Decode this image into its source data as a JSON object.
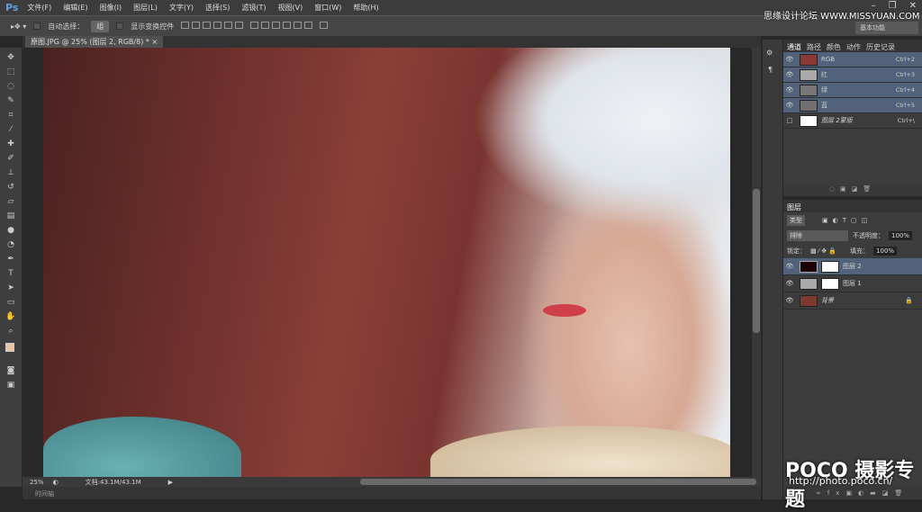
{
  "app": {
    "logo": "Ps",
    "window_controls": [
      "–",
      "❐",
      "✕"
    ]
  },
  "menu": [
    "文件(F)",
    "编辑(E)",
    "图像(I)",
    "图层(L)",
    "文字(Y)",
    "选择(S)",
    "滤镜(T)",
    "视图(V)",
    "窗口(W)",
    "帮助(H)"
  ],
  "options": {
    "auto_select_label": "自动选择：",
    "auto_select_value": "组",
    "show_transform_label": "显示变换控件",
    "workspace": "基本功能"
  },
  "watermark": "思缘设计论坛 WWW.MISSYUAN.COM",
  "document": {
    "tab_title": "原图.JPG @ 25% (图层 2, RGB/8) *",
    "close": "×",
    "zoom": "25%",
    "doc_size": "文档:43.1M/43.1M"
  },
  "timeline_label": "时间轴",
  "channels_panel": {
    "tabs": [
      "通道",
      "路径",
      "颜色",
      "动作",
      "历史记录"
    ],
    "rows": [
      {
        "name": "RGB",
        "shortcut": "Ctrl+2"
      },
      {
        "name": "红",
        "shortcut": "Ctrl+3"
      },
      {
        "name": "绿",
        "shortcut": "Ctrl+4"
      },
      {
        "name": "蓝",
        "shortcut": "Ctrl+5"
      },
      {
        "name": "图层 2蒙版",
        "shortcut": "Ctrl+\\"
      }
    ]
  },
  "layers_panel": {
    "title": "图层",
    "filter": "类型",
    "blend_mode": "排除",
    "opacity_label": "不透明度：",
    "opacity": "100%",
    "lock_label": "锁定：",
    "fill_label": "填充：",
    "fill": "100%",
    "layers": [
      {
        "name": "图层 2"
      },
      {
        "name": "图层 1"
      },
      {
        "name": "背景"
      }
    ]
  },
  "branding": {
    "poco": "POCO 摄影专题",
    "url": "http://photo.poco.cn/"
  }
}
